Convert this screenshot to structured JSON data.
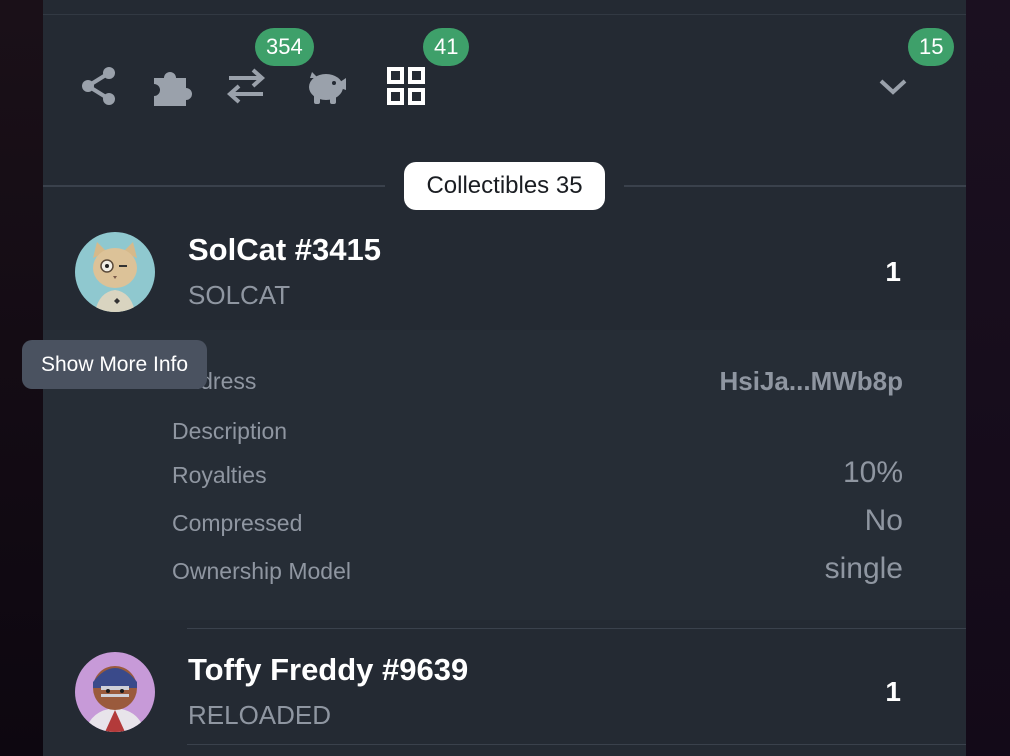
{
  "toolbar": {
    "icons": [
      "share-icon",
      "puzzle-icon",
      "swap-icon",
      "piggy-bank-icon",
      "grid-icon",
      "chevron-down-icon"
    ],
    "badges": {
      "swap": "354",
      "grid": "41",
      "chevron": "15"
    },
    "accent": "#3ea06a"
  },
  "section": {
    "label": "Collectibles 35"
  },
  "items": [
    {
      "name": "SolCat #3415",
      "symbol": "SOLCAT",
      "quantity": "1",
      "details": [
        {
          "label": "Address",
          "value": "HsiJa...MWb8p"
        },
        {
          "label": "Description",
          "value": ""
        },
        {
          "label": "Royalties",
          "value": "10%"
        },
        {
          "label": "Compressed",
          "value": "No"
        },
        {
          "label": "Ownership Model",
          "value": "single"
        }
      ]
    },
    {
      "name": "Toffy Freddy #9639",
      "symbol": "RELOADED",
      "quantity": "1"
    }
  ],
  "tooltip": {
    "text": "Show More Info"
  }
}
